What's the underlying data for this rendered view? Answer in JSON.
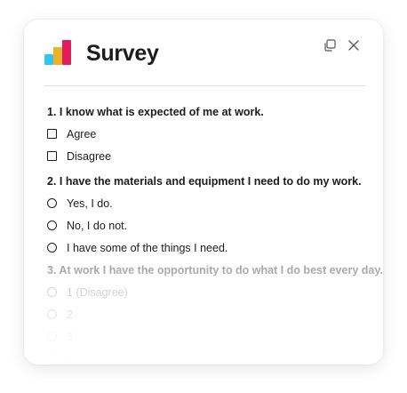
{
  "header": {
    "title": "Survey",
    "logo_icon": "bar-chart-logo-icon",
    "copy_icon": "copy-icon",
    "close_icon": "close-icon"
  },
  "colors": {
    "logo_blue": "#36c5f0",
    "logo_yellow": "#ecb22e",
    "logo_red": "#e01e5a",
    "text": "#1d1c1d"
  },
  "questions": [
    {
      "title": "1. I know what is expected of me at work.",
      "type": "checkbox",
      "options": [
        "Agree",
        "Disagree"
      ]
    },
    {
      "title": "2. I have the materials and equipment I need to do my work.",
      "type": "radio",
      "options": [
        "Yes, I do.",
        "No, I do not.",
        "I have some of the things I need."
      ]
    },
    {
      "title": "3. At work I have the opportunity to do what I do best every day.",
      "type": "radio",
      "options": [
        "1 (Disagree)",
        "2",
        "3",
        "4"
      ]
    }
  ]
}
